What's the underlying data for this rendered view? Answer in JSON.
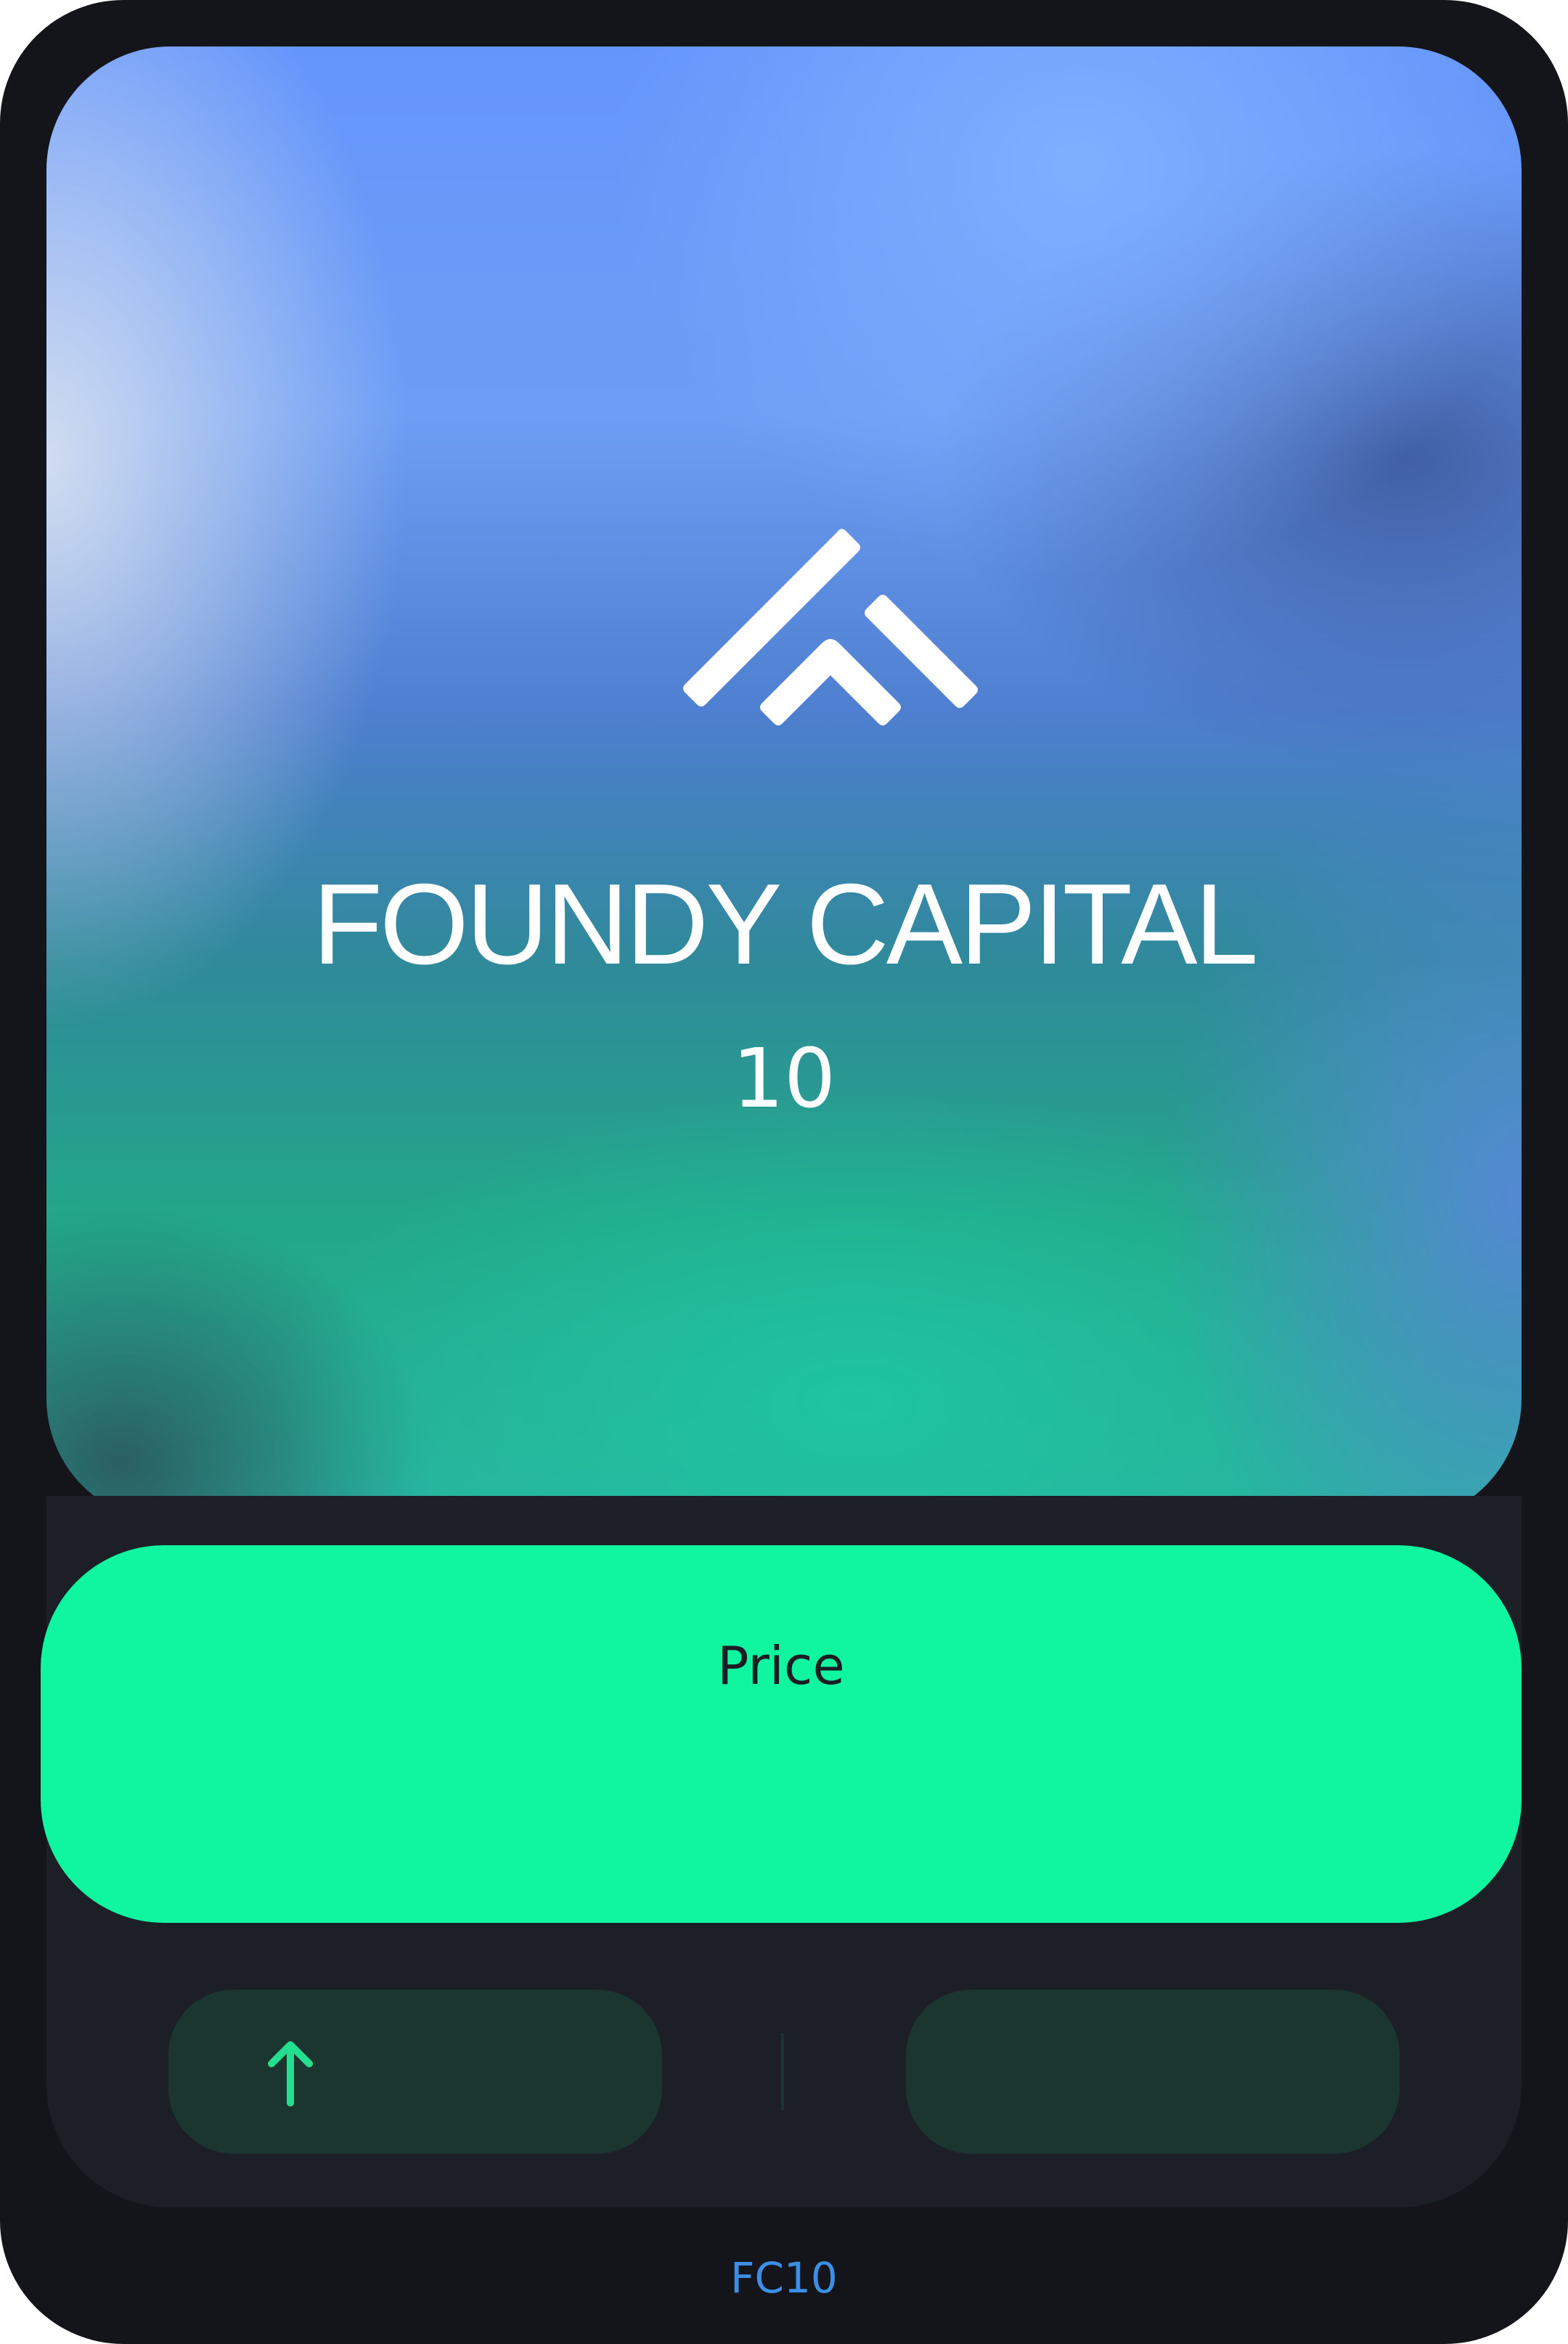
{
  "hero": {
    "logo_icon": "foundy-capital-logo-icon",
    "company_name": "FOUNDY CAPITAL",
    "company_number": "10"
  },
  "price_panel": {
    "label": "Price",
    "color": "#0ff5a0"
  },
  "stats": {
    "left_icon": "arrow-up-icon",
    "pill_color": "#1b352f",
    "arrow_color": "#22e08f"
  },
  "footer": {
    "ticker": "FC10",
    "ticker_color": "#3b8fe6"
  }
}
